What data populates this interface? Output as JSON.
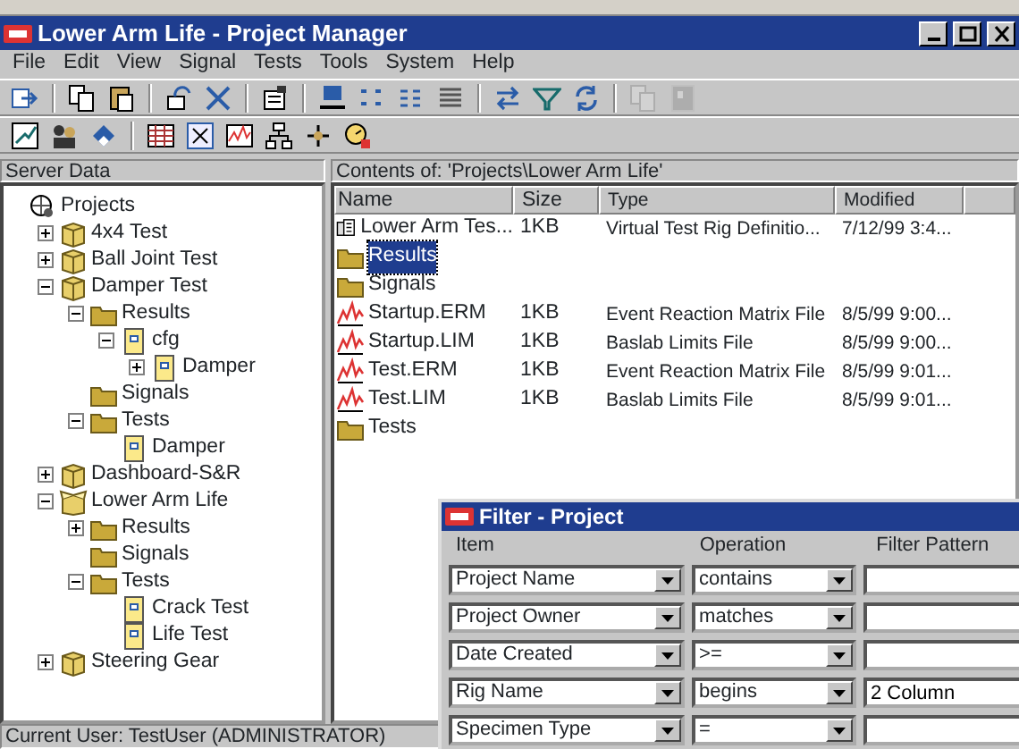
{
  "window": {
    "title": "Lower Arm Life - Project Manager"
  },
  "menu": [
    "File",
    "Edit",
    "View",
    "Signal",
    "Tests",
    "Tools",
    "System",
    "Help"
  ],
  "toolbar_1": [
    {
      "kind": "button",
      "disabled": false
    },
    {
      "kind": "separator"
    },
    {
      "kind": "button",
      "disabled": false
    },
    {
      "kind": "button",
      "disabled": false
    },
    {
      "kind": "separator"
    },
    {
      "kind": "button",
      "disabled": false
    },
    {
      "kind": "button",
      "disabled": false
    },
    {
      "kind": "separator"
    },
    {
      "kind": "button",
      "disabled": false
    },
    {
      "kind": "separator"
    },
    {
      "kind": "button",
      "disabled": false
    },
    {
      "kind": "button",
      "disabled": false
    },
    {
      "kind": "button",
      "disabled": false
    },
    {
      "kind": "button",
      "disabled": false
    },
    {
      "kind": "separator"
    },
    {
      "kind": "button",
      "disabled": false
    },
    {
      "kind": "button",
      "disabled": false
    },
    {
      "kind": "button",
      "disabled": false
    },
    {
      "kind": "separator"
    },
    {
      "kind": "button",
      "disabled": true
    },
    {
      "kind": "button",
      "disabled": true
    }
  ],
  "toolbar_2": [
    {
      "kind": "button",
      "disabled": false
    },
    {
      "kind": "button",
      "disabled": false
    },
    {
      "kind": "button",
      "disabled": false
    },
    {
      "kind": "separator"
    },
    {
      "kind": "button",
      "disabled": false
    },
    {
      "kind": "button",
      "disabled": false
    },
    {
      "kind": "button",
      "disabled": false
    },
    {
      "kind": "button",
      "disabled": false
    },
    {
      "kind": "button",
      "disabled": false
    },
    {
      "kind": "button",
      "disabled": false
    }
  ],
  "sidebar": {
    "header": "Server Data",
    "tree": [
      {
        "label": "Projects",
        "kind": "root",
        "children": [
          {
            "label": "4x4 Test",
            "kind": "project",
            "expanded": false
          },
          {
            "label": "Ball Joint Test",
            "kind": "project",
            "expanded": false
          },
          {
            "label": "Damper Test",
            "kind": "project",
            "expanded": true,
            "children": [
              {
                "label": "Results",
                "kind": "folder",
                "expanded": true,
                "children": [
                  {
                    "label": "cfg",
                    "kind": "file",
                    "expanded": true,
                    "children": [
                      {
                        "label": "Damper",
                        "kind": "file",
                        "expanded": false
                      }
                    ]
                  }
                ]
              },
              {
                "label": "Signals",
                "kind": "folder"
              },
              {
                "label": "Tests",
                "kind": "folder",
                "expanded": true,
                "children": [
                  {
                    "label": "Damper",
                    "kind": "file"
                  }
                ]
              }
            ]
          },
          {
            "label": "Dashboard-S&R",
            "kind": "project",
            "expanded": false
          },
          {
            "label": "Lower Arm Life",
            "kind": "open-project",
            "expanded": true,
            "children": [
              {
                "label": "Results",
                "kind": "folder",
                "expanded": false
              },
              {
                "label": "Signals",
                "kind": "folder"
              },
              {
                "label": "Tests",
                "kind": "folder",
                "expanded": true,
                "children": [
                  {
                    "label": "Crack Test",
                    "kind": "file"
                  },
                  {
                    "label": "Life Test",
                    "kind": "file"
                  }
                ]
              }
            ]
          },
          {
            "label": "Steering Gear",
            "kind": "project",
            "expanded": false
          }
        ]
      }
    ]
  },
  "contents": {
    "header": "Contents of: 'Projects\\Lower Arm Life'",
    "columns": [
      "Name",
      "Size",
      "Type",
      "Modified"
    ],
    "rows": [
      {
        "kind": "rig",
        "name": "Lower Arm Tes...",
        "size": "1KB",
        "type": "Virtual Test Rig Definitio...",
        "modified": "7/12/99 3:4...",
        "selected": false
      },
      {
        "kind": "folder",
        "name": "Results",
        "selected": true
      },
      {
        "kind": "folder",
        "name": "Signals",
        "selected": false
      },
      {
        "kind": "chart",
        "name": "Startup.ERM",
        "size": "1KB",
        "type": "Event Reaction Matrix File",
        "modified": "8/5/99 9:00...",
        "selected": false
      },
      {
        "kind": "chart",
        "name": "Startup.LIM",
        "size": "1KB",
        "type": "Baslab Limits File",
        "modified": "8/5/99 9:00...",
        "selected": false
      },
      {
        "kind": "chart",
        "name": "Test.ERM",
        "size": "1KB",
        "type": "Event Reaction Matrix File",
        "modified": "8/5/99 9:01...",
        "selected": false
      },
      {
        "kind": "chart",
        "name": "Test.LIM",
        "size": "1KB",
        "type": "Baslab Limits File",
        "modified": "8/5/99 9:01...",
        "selected": false
      },
      {
        "kind": "folder",
        "name": "Tests",
        "selected": false
      }
    ]
  },
  "status_bar": "Current User: TestUser (ADMINISTRATOR)",
  "filter_dialog": {
    "title": "Filter - Project",
    "columns": [
      "Item",
      "Operation",
      "Filter Pattern"
    ],
    "rows": [
      {
        "item": "Project Name",
        "operation": "contains",
        "pattern": ""
      },
      {
        "item": "Project Owner",
        "operation": "matches",
        "pattern": ""
      },
      {
        "item": "Date Created",
        "operation": ">=",
        "pattern": ""
      },
      {
        "item": "Rig Name",
        "operation": "begins",
        "pattern": "2 Column"
      },
      {
        "item": "Specimen Type",
        "operation": "=",
        "pattern": ""
      }
    ]
  }
}
